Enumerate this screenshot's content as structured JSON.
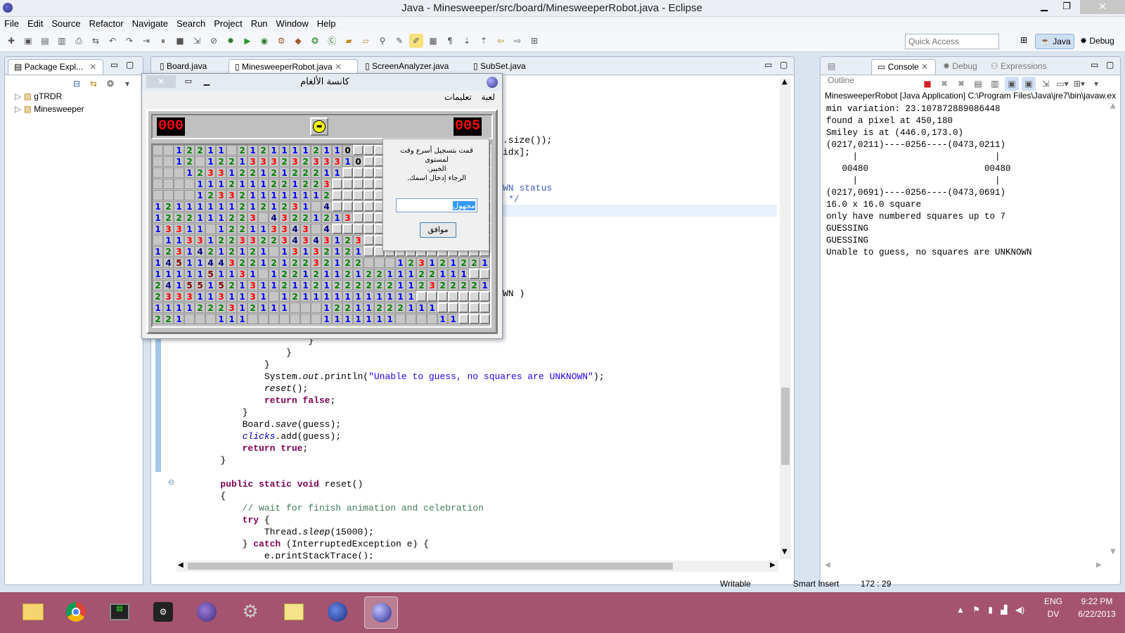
{
  "window": {
    "title": "Java - Minesweeper/src/board/MinesweeperRobot.java - Eclipse"
  },
  "menubar": {
    "items": [
      "File",
      "Edit",
      "Source",
      "Refactor",
      "Navigate",
      "Search",
      "Project",
      "Run",
      "Window",
      "Help"
    ]
  },
  "toolbar": {
    "quick_access_placeholder": "Quick Access",
    "perspectives": [
      "Java",
      "Debug"
    ]
  },
  "package_explorer": {
    "title": "Package Expl...",
    "projects": [
      "gTRDR",
      "Minesweeper"
    ]
  },
  "editor": {
    "tabs": [
      "Board.java",
      "MinesweeperRobot.java",
      "ScreenAnalyzer.java",
      "SubSet.java"
    ],
    "active_tab": "MinesweeperRobot.java",
    "visible_fragments": [
      ".size());",
      "idx];",
      "WN status",
      "*/",
      "WN )"
    ]
  },
  "right_panel": {
    "tabs": [
      "Outline",
      "Console",
      "Debug",
      "Expressions"
    ],
    "active_tab": "Console",
    "console_header": "MinesweeperRobot [Java Application] C:\\Program Files\\Java\\jre7\\bin\\javaw.exe",
    "console_lines": [
      "min variation: 23.107872889086448",
      "found a pixel at 450,180",
      "Smiley is at (446.0,173.0)",
      "(0217,0211)----0256----(0473,0211)",
      "     |                          |",
      "   00480                      00480",
      "     |                          |",
      "(0217,0691)----0256----(0473,0691)",
      "16.0 x 16.0 square",
      "only have numbered squares up to 7",
      "GUESSING",
      "GUESSING",
      "Unable to guess, no squares are UNKNOWN"
    ]
  },
  "minesweeper": {
    "title": "كانسة الألغام",
    "menu": [
      "لعبة",
      "تعليمات"
    ],
    "mine_counter": "000",
    "timer": "005",
    "dialog_text": [
      "قمت بتسجيل أسرع وقت",
      "لمستوى",
      "الخبير.",
      "الرجاء إدخال اسمك."
    ],
    "name_input": "مجهول",
    "ok_button": "موافق",
    "board_rows": [
      "..12211.21211112110",
      "..12.122133323233310",
      "...123312212122211",
      "....1112111221223",
      "....1233211111112",
      "121111112121231.4",
      "1222111223.43221213",
      "13311.122113343.4",
      ".1133122332234343123",
      "12314212121.13132121",
      "14511443221212232122...123121221",
      "1111151131.1221211212211122111",
      "24155152131121121222222112322221",
      "23331131131.1211111111111",
      "1111222312111...12211222111",
      "221...111.......1111111....11"
    ]
  },
  "status_bar": {
    "mode": "Writable",
    "insert": "Smart Insert",
    "position": "172 : 29"
  },
  "taskbar": {
    "language": "ENG",
    "layout": "DV",
    "time": "9:22 PM",
    "date": "6/22/2013"
  }
}
